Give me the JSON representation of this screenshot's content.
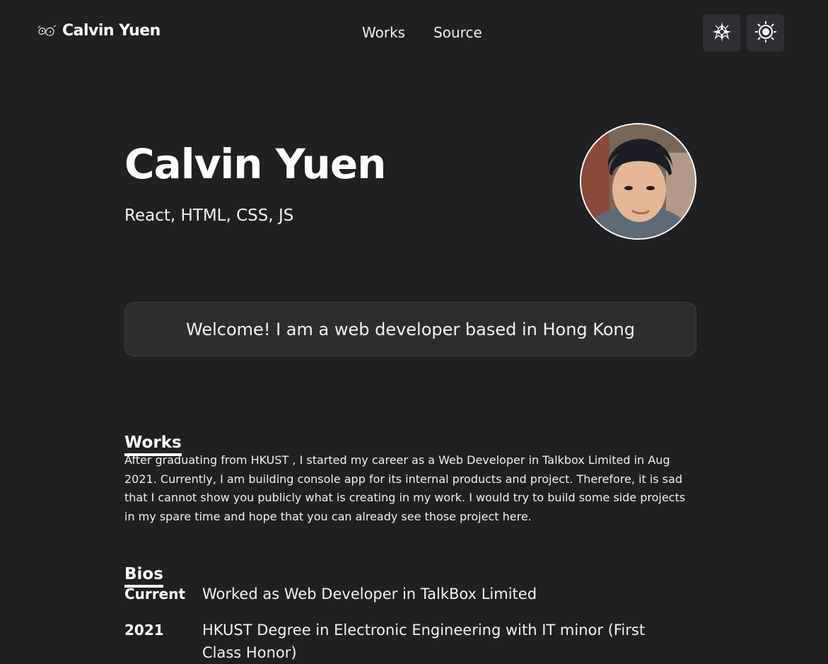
{
  "nav": {
    "brand_name": "Calvin Yuen",
    "brand_icon": "paw-logo-icon",
    "links": [
      {
        "label": "Works"
      },
      {
        "label": "Source"
      }
    ],
    "actions": [
      {
        "icon": "sparkle-icon"
      },
      {
        "icon": "sun-icon"
      }
    ]
  },
  "hero": {
    "title": "Calvin Yuen",
    "subtitle": "React, HTML, CSS, JS"
  },
  "welcome": {
    "text": "Welcome! I am a web developer based in Hong Kong"
  },
  "works": {
    "heading": "Works",
    "paragraph": "After graduating from HKUST , I started my career as a Web Developer in Talkbox Limited in Aug 2021. Currently, I am building console app for its internal products and project. Therefore, it is sad that I cannot show you publicly what is creating in my work. I would try to build some side projects in my spare time and hope that you can already see those project here."
  },
  "bios": {
    "heading": "Bios",
    "items": [
      {
        "year": "Current",
        "description": "Worked as Web Developer in TalkBox Limited"
      },
      {
        "year": "2021",
        "description": "HKUST Degree in Electronic Engineering with IT minor (First Class Honor)"
      }
    ]
  },
  "colors": {
    "background": "#202023",
    "text": "#ffffff",
    "button_bg": "#2f2f33",
    "welcome_bg": "#2d2d30"
  }
}
